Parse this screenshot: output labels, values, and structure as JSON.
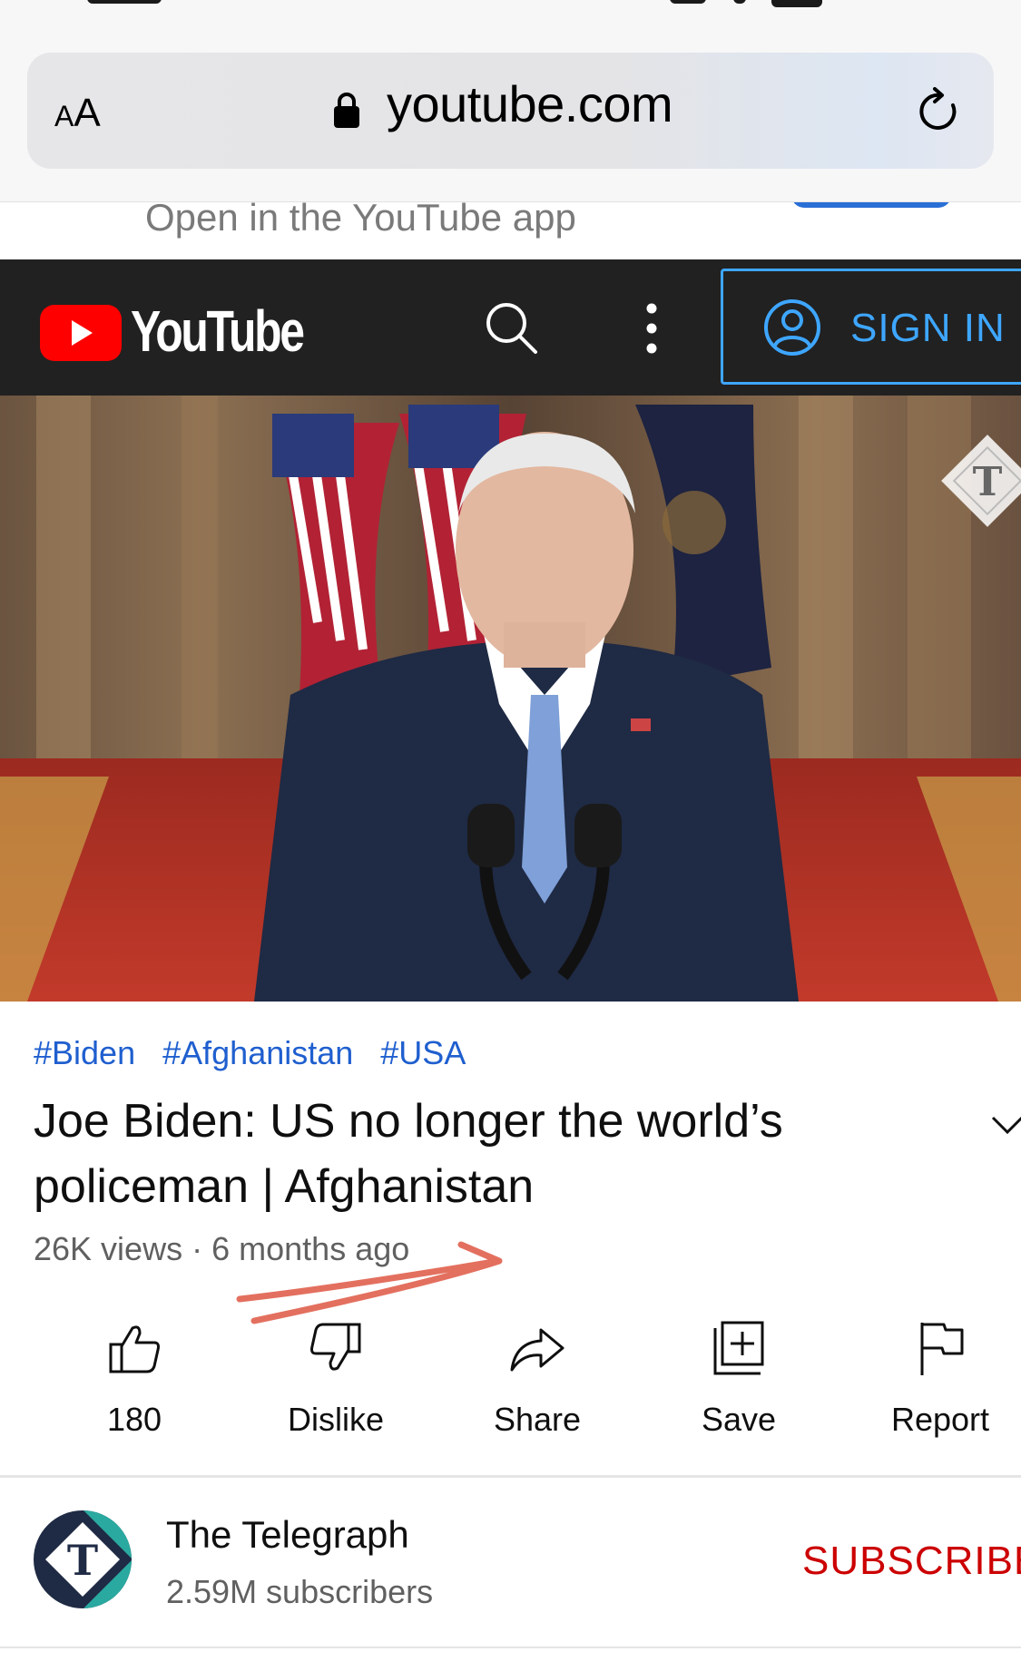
{
  "browser": {
    "text_size_label_small": "A",
    "text_size_label_large": "A",
    "url": "youtube.com",
    "open_in_app_text": "Open in the YouTube app"
  },
  "youtube_header": {
    "logo_text": "YouTube",
    "sign_in_label": "SIGN IN",
    "colors": {
      "header_bg": "#212121",
      "logo_red": "#ff0000",
      "sign_in_blue": "#3ea6ff"
    }
  },
  "video": {
    "hashtags": [
      "#Biden",
      "#Afghanistan",
      "#USA"
    ],
    "title": "Joe Biden: US no longer the world’s policeman | Afghanistan",
    "views": "26K views",
    "separator": "·",
    "age": "6 months ago"
  },
  "actions": [
    {
      "label": "180",
      "icon": "thumbs-up-icon"
    },
    {
      "label": "Dislike",
      "icon": "thumbs-down-icon"
    },
    {
      "label": "Share",
      "icon": "share-arrow-icon"
    },
    {
      "label": "Save",
      "icon": "save-to-playlist-icon"
    },
    {
      "label": "Report",
      "icon": "flag-icon"
    }
  ],
  "channel": {
    "name": "The Telegraph",
    "subscribers": "2.59M subscribers",
    "subscribe_label": "SUBSCRIBE",
    "subscribe_color": "#cc0000"
  }
}
